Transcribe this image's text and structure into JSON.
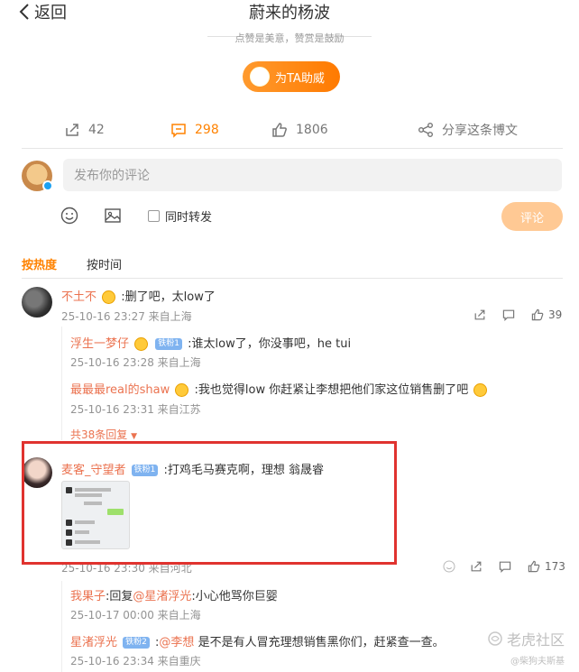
{
  "header": {
    "back_label": "返回",
    "title": "蔚来的杨波",
    "subline": "点赞是美意，赞赏是鼓励",
    "boost_label": "为TA助威"
  },
  "actions": {
    "forward_count": "42",
    "comment_count": "298",
    "like_count": "1806",
    "share_label": "分享这条博文"
  },
  "composer": {
    "placeholder": "发布你的评论",
    "repost_label": "同时转发",
    "submit_label": "评论"
  },
  "sort": {
    "hot_label": "按热度",
    "time_label": "按时间"
  },
  "comments": [
    {
      "user": "不土不",
      "text": ":删了吧，太low了",
      "meta": "25-10-16 23:27 来自上海",
      "likes": "39",
      "replies": [
        {
          "user": "浮生一梦仔",
          "badge": "铁粉1",
          "text": ":谁太low了，你没事吧，he tui",
          "meta": "25-10-16 23:28 来自上海"
        },
        {
          "user": "最最最real的shaw",
          "text": ":我也觉得low 你赶紧让李想把他们家这位销售删了吧",
          "meta": "25-10-16 23:31 来自江苏"
        }
      ],
      "more_label": "共38条回复"
    },
    {
      "user": "麦客_守望者",
      "badge": "铁粉1",
      "text": ":打鸡毛马赛克啊，理想 翁晟睿",
      "meta": "25-10-16 23:30 来自河北",
      "likes": "173",
      "replies": [
        {
          "user": "我果子",
          "text_pre": ":回复",
          "mention": "@星渚浮光",
          "text": ":小心他骂你巨婴",
          "meta": "25-10-17 00:00 来自上海"
        },
        {
          "user": "星渚浮光",
          "badge": "铁粉2",
          "mention": "@李想",
          "text": " 是不是有人冒充理想销售黑你们，赶紧查一查。",
          "meta": "25-10-16 23:34 来自重庆"
        }
      ]
    }
  ],
  "watermark": {
    "main": "老虎社区",
    "sub": "@柴狗夫斯基"
  },
  "colors": {
    "accent": "#ff8200",
    "username": "#eb7350",
    "highlight_box": "#e0332f"
  }
}
